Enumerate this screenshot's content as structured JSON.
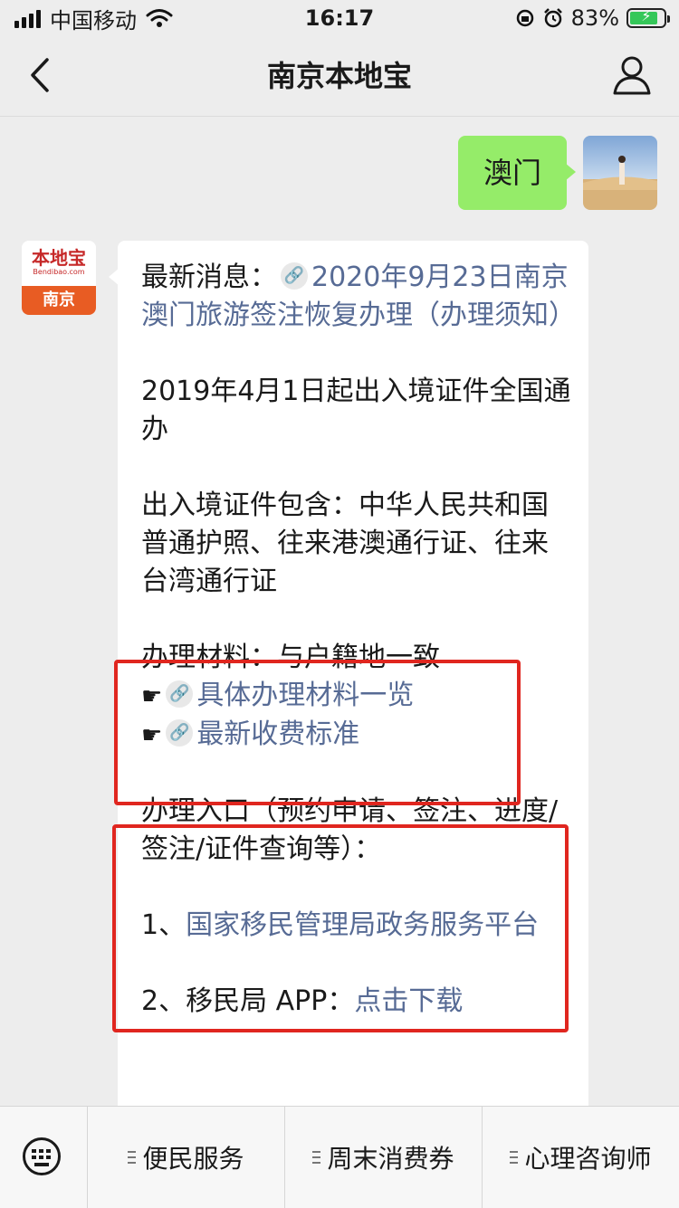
{
  "status_bar": {
    "carrier": "中国移动",
    "time": "16:17",
    "battery_percent": "83%",
    "battery_level": 0.83
  },
  "nav": {
    "title": "南京本地宝"
  },
  "outgoing_message": {
    "text": "澳门"
  },
  "bot_avatar": {
    "brand_name": "本地宝",
    "brand_domain": "Bendibao.com",
    "city": "南京"
  },
  "reply": {
    "p1_prefix": "最新消息：",
    "p1_link": "2020年9月23日南京澳门旅游签注恢复办理（办理须知）",
    "p2": "2019年4月1日起出入境证件全国通办",
    "p3": "出入境证件包含：中华人民共和国普通护照、往来港澳通行证、往来台湾通行证",
    "p4_line1": "办理材料：与户籍地一致",
    "p4_hand": "☛",
    "p4_link1": "具体办理材料一览",
    "p4_link2": "最新收费标准",
    "p5_line": "办理入口（预约申请、签注、进度/签注/证件查询等）：",
    "p6_prefix": "1、",
    "p6_link": "国家移民管理局政务服务平台",
    "p7_prefix": "2、移民局 APP：",
    "p7_link": "点击下载"
  },
  "bottom_menu": {
    "items": [
      "便民服务",
      "周末消费券",
      "心理咨询师"
    ]
  },
  "colors": {
    "link": "#576b95",
    "outgoing_bubble": "#95ec69",
    "highlight_box": "#e0261f"
  }
}
